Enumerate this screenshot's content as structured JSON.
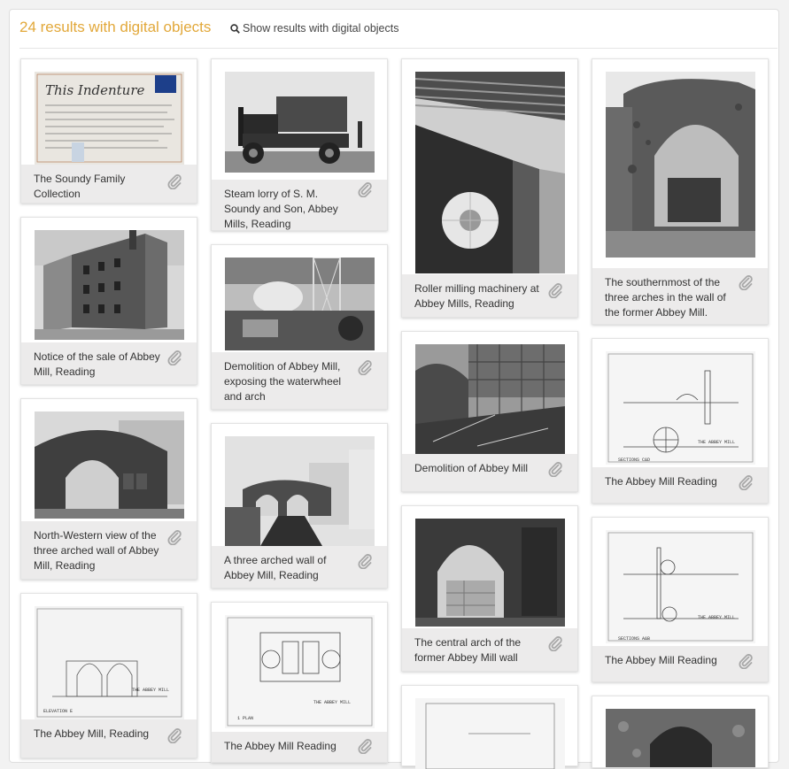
{
  "header": {
    "title": "24 results with digital objects",
    "show_link": "Show results with digital objects"
  },
  "icons": {
    "search": "search-icon",
    "attachment": "paperclip-icon"
  },
  "results": [
    {
      "caption": "The Soundy Family Collection",
      "image": "indenture-document"
    },
    {
      "caption": "Notice of the sale of Abbey Mill, Reading",
      "image": "brick-mill-building"
    },
    {
      "caption": "North-Western view of the three arched wall of Abbey Mill, Reading",
      "image": "three-arched-wall"
    },
    {
      "caption": "The Abbey Mill, Reading",
      "image": "elevation-drawing"
    },
    {
      "caption": "Steam lorry of S. M. Soundy and Son, Abbey Mills, Reading",
      "image": "steam-lorry"
    },
    {
      "caption": "Demolition of Abbey Mill, exposing the waterwheel and arch",
      "image": "demolition-site"
    },
    {
      "caption": "A three arched wall of Abbey Mill, Reading",
      "image": "arched-wall-over-river"
    },
    {
      "caption": "The Abbey Mill Reading",
      "image": "plan-drawing"
    },
    {
      "caption": "Roller milling machinery at Abbey Mills, Reading",
      "image": "milling-machinery"
    },
    {
      "caption": "Demolition of Abbey Mill",
      "image": "demolition-rubble"
    },
    {
      "caption": "The central arch of the former Abbey Mill wall",
      "image": "central-arch"
    },
    {
      "caption": "",
      "image": "architectural-drawing"
    },
    {
      "caption": "The southernmost of the three arches in the wall of the former Abbey Mill.",
      "image": "southern-arch-ruin"
    },
    {
      "caption": "The Abbey Mill Reading",
      "image": "sections-drawing-cd"
    },
    {
      "caption": "The Abbey Mill Reading",
      "image": "sections-drawing-ab"
    },
    {
      "caption": "",
      "image": "stone-arch-photo"
    }
  ]
}
